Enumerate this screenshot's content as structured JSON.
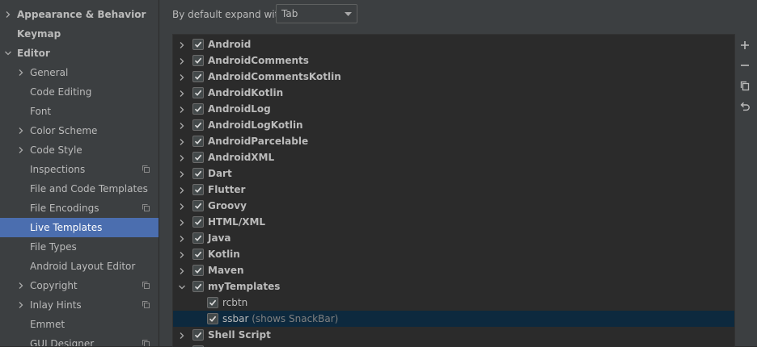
{
  "sidebar": {
    "items": [
      {
        "label": "Appearance & Behavior",
        "bold": true,
        "chevron": "right",
        "level": 0
      },
      {
        "label": "Keymap",
        "bold": true,
        "chevron": "none",
        "level": 0
      },
      {
        "label": "Editor",
        "bold": true,
        "chevron": "down",
        "level": 0
      },
      {
        "label": "General",
        "chevron": "right",
        "level": 1
      },
      {
        "label": "Code Editing",
        "chevron": "none",
        "level": 1
      },
      {
        "label": "Font",
        "chevron": "none",
        "level": 1
      },
      {
        "label": "Color Scheme",
        "chevron": "right",
        "level": 1
      },
      {
        "label": "Code Style",
        "chevron": "right",
        "level": 1
      },
      {
        "label": "Inspections",
        "chevron": "none",
        "level": 1,
        "copy_icon": true
      },
      {
        "label": "File and Code Templates",
        "chevron": "none",
        "level": 1
      },
      {
        "label": "File Encodings",
        "chevron": "none",
        "level": 1,
        "copy_icon": true
      },
      {
        "label": "Live Templates",
        "chevron": "none",
        "level": 1,
        "selected": true
      },
      {
        "label": "File Types",
        "chevron": "none",
        "level": 1
      },
      {
        "label": "Android Layout Editor",
        "chevron": "none",
        "level": 1
      },
      {
        "label": "Copyright",
        "chevron": "right",
        "level": 1,
        "copy_icon": true
      },
      {
        "label": "Inlay Hints",
        "chevron": "right",
        "level": 1,
        "copy_icon": true
      },
      {
        "label": "Emmet",
        "chevron": "none",
        "level": 1
      },
      {
        "label": "GUI Designer",
        "chevron": "none",
        "level": 1,
        "copy_icon": true
      }
    ]
  },
  "expand": {
    "label": "By default expand with",
    "value": "Tab"
  },
  "tree": {
    "rows": [
      {
        "label": "Android",
        "type": "group",
        "expanded": false,
        "checked": true
      },
      {
        "label": "AndroidComments",
        "type": "group",
        "expanded": false,
        "checked": true
      },
      {
        "label": "AndroidCommentsKotlin",
        "type": "group",
        "expanded": false,
        "checked": true
      },
      {
        "label": "AndroidKotlin",
        "type": "group",
        "expanded": false,
        "checked": true
      },
      {
        "label": "AndroidLog",
        "type": "group",
        "expanded": false,
        "checked": true
      },
      {
        "label": "AndroidLogKotlin",
        "type": "group",
        "expanded": false,
        "checked": true
      },
      {
        "label": "AndroidParcelable",
        "type": "group",
        "expanded": false,
        "checked": true
      },
      {
        "label": "AndroidXML",
        "type": "group",
        "expanded": false,
        "checked": true
      },
      {
        "label": "Dart",
        "type": "group",
        "expanded": false,
        "checked": true
      },
      {
        "label": "Flutter",
        "type": "group",
        "expanded": false,
        "checked": true
      },
      {
        "label": "Groovy",
        "type": "group",
        "expanded": false,
        "checked": true
      },
      {
        "label": "HTML/XML",
        "type": "group",
        "expanded": false,
        "checked": true
      },
      {
        "label": "Java",
        "type": "group",
        "expanded": false,
        "checked": true
      },
      {
        "label": "Kotlin",
        "type": "group",
        "expanded": false,
        "checked": true
      },
      {
        "label": "Maven",
        "type": "group",
        "expanded": false,
        "checked": true
      },
      {
        "label": "myTemplates",
        "type": "group",
        "expanded": true,
        "checked": true
      },
      {
        "label": "rcbtn",
        "type": "template",
        "checked": true
      },
      {
        "label": "ssbar",
        "description": "(shows SnackBar)",
        "type": "template",
        "checked": true,
        "selected": true
      },
      {
        "label": "Shell Script",
        "type": "group",
        "expanded": false,
        "checked": true
      },
      {
        "label": "",
        "type": "group",
        "expanded": false,
        "checked": true
      }
    ]
  },
  "toolbar": {
    "buttons": [
      {
        "icon": "plus-icon",
        "name": "add-button"
      },
      {
        "icon": "minus-icon",
        "name": "remove-button"
      },
      {
        "icon": "copy-icon",
        "name": "duplicate-button"
      },
      {
        "icon": "undo-icon",
        "name": "restore-defaults-button"
      }
    ]
  },
  "colors": {
    "sidebar_bg": "#3c3f41",
    "selection": "#4b6eaf",
    "tree_bg": "#2b2b2b",
    "tree_selection": "#0d293e",
    "text": "#bbbbbb"
  }
}
